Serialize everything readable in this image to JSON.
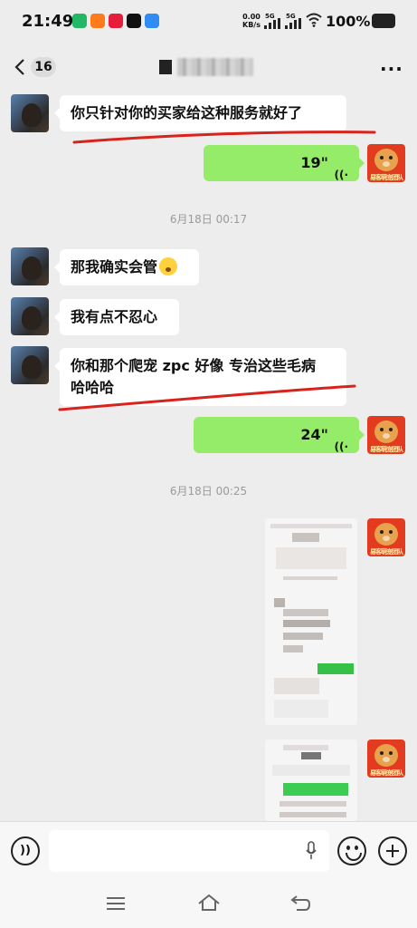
{
  "status_bar": {
    "time": "21:49",
    "net_speed_value": "0.00",
    "net_speed_unit": "KB/s",
    "sim1": "5G",
    "sim2": "5G",
    "battery": "100%"
  },
  "header": {
    "unread_count": "16",
    "title": "",
    "more": "···"
  },
  "messages": [
    {
      "side": "left",
      "text": "你只针对你的买家给这种服务就好了"
    },
    {
      "side": "right",
      "type": "voice",
      "duration": "19\""
    },
    {
      "type": "time",
      "text": "6月18日 00:17"
    },
    {
      "side": "left",
      "text": "那我确实会管"
    },
    {
      "side": "left",
      "text": "我有点不忍心"
    },
    {
      "side": "left",
      "line1": "你和那个爬宠 zpc 好像 专治这些毛病",
      "line2": "哈哈哈"
    },
    {
      "side": "right",
      "type": "voice",
      "duration": "24\""
    },
    {
      "type": "time",
      "text": "6月18日 00:25"
    },
    {
      "side": "right",
      "type": "image"
    },
    {
      "side": "right",
      "type": "image"
    }
  ],
  "avatar_right_tag": "易客萌宠团队",
  "icons": {
    "voice_wave": "voice-wave-icon",
    "back": "chevron-left-icon",
    "mic": "mic-icon",
    "emoji": "emoji-icon",
    "plus": "plus-icon"
  },
  "colors": {
    "background": "#ededed",
    "bubble_left": "#ffffff",
    "bubble_right": "#95ec69",
    "annotation": "#d8231c"
  }
}
